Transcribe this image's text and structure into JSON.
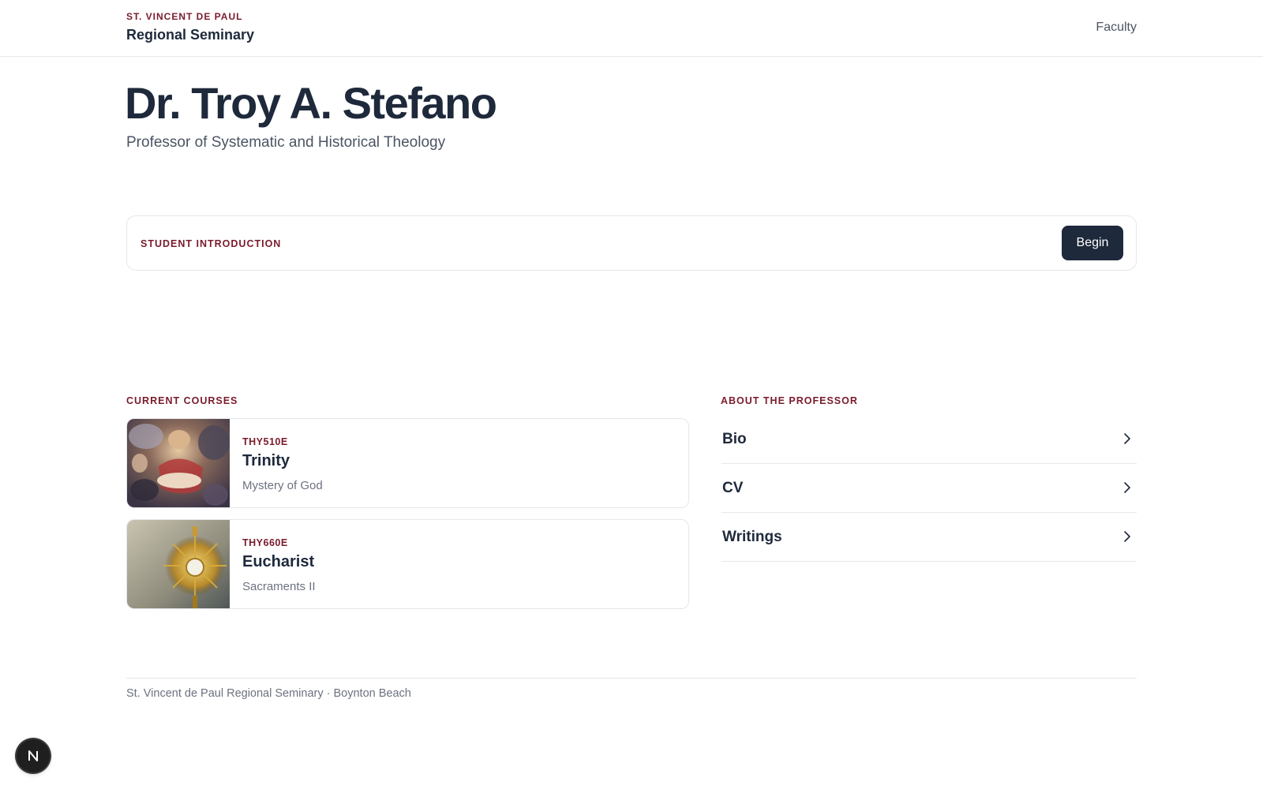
{
  "header": {
    "kicker": "ST. VINCENT DE PAUL",
    "name": "Regional Seminary",
    "nav_faculty": "Faculty"
  },
  "profile": {
    "name": "Dr. Troy A. Stefano",
    "title": "Professor of Systematic and Historical Theology"
  },
  "intro": {
    "label": "STUDENT INTRODUCTION",
    "button": "Begin"
  },
  "courses": {
    "label": "CURRENT COURSES",
    "items": [
      {
        "code": "THY510E",
        "title": "Trinity",
        "subtitle": "Mystery of God",
        "thumb": "trinity-painting"
      },
      {
        "code": "THY660E",
        "title": "Eucharist",
        "subtitle": "Sacraments II",
        "thumb": "monstrance"
      }
    ]
  },
  "about": {
    "label": "ABOUT THE PROFESSOR",
    "items": [
      {
        "label": "Bio",
        "icon": "chevron-right-icon"
      },
      {
        "label": "CV",
        "icon": "chevron-right-icon"
      },
      {
        "label": "Writings",
        "icon": "chevron-right-icon"
      }
    ]
  },
  "footer": {
    "text": "St. Vincent de Paul Regional Seminary · Boynton Beach"
  },
  "badge": {
    "letter": "N"
  },
  "colors": {
    "accent": "#7a1b2b",
    "ink": "#1e293b",
    "muted": "#6b7280",
    "border": "#e5e7eb"
  }
}
